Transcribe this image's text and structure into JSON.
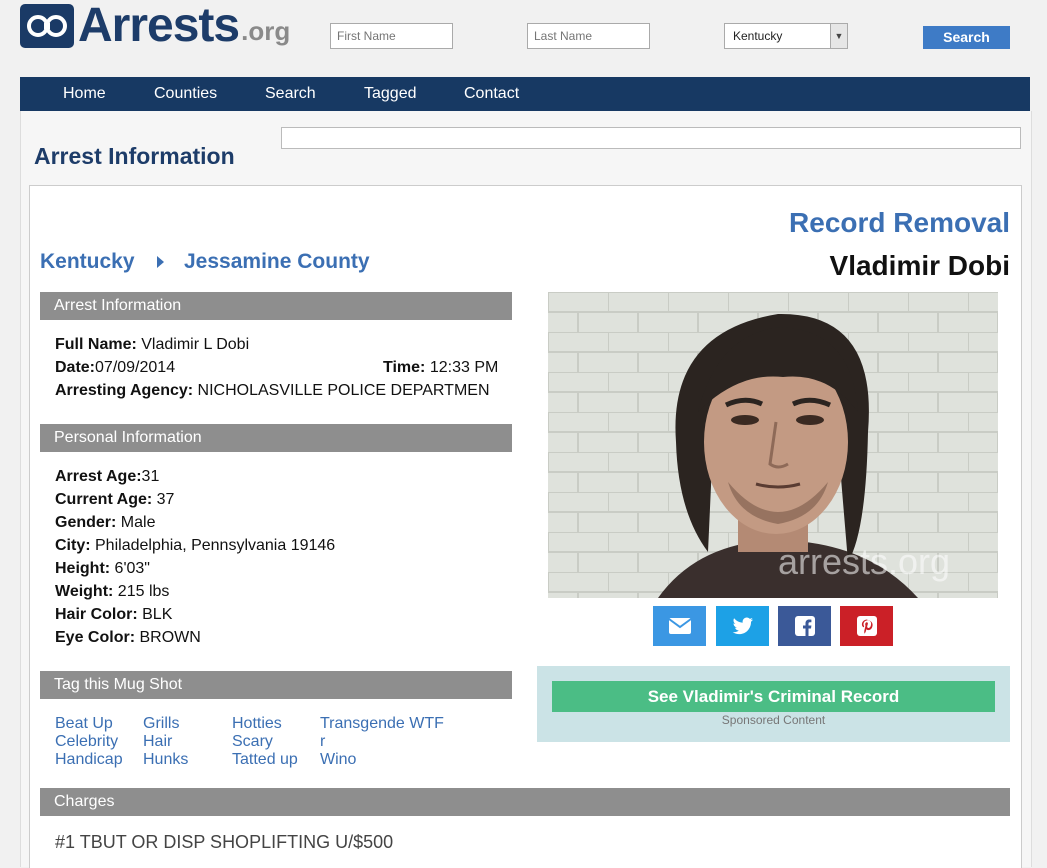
{
  "header": {
    "logo_word": "Arrests",
    "logo_tld": ".org",
    "first_name_placeholder": "First Name",
    "last_name_placeholder": "Last Name",
    "state_selected": "Kentucky",
    "search_label": "Search"
  },
  "nav": {
    "items": [
      "Home",
      "Counties",
      "Search",
      "Tagged",
      "Contact"
    ]
  },
  "page": {
    "title": "Arrest Information"
  },
  "breadcrumb": {
    "state": "Kentucky",
    "county": "Jessamine County"
  },
  "record_removal": "Record Removal",
  "person_name": "Vladimir Dobi",
  "arrest_info": {
    "header": "Arrest Information",
    "full_name_label": "Full Name:",
    "full_name": " Vladimir L Dobi",
    "date_label": "Date:",
    "date": "07/09/2014",
    "time_label": "Time:",
    "time": " 12:33 PM",
    "agency_label": "Arresting Agency:",
    "agency": " NICHOLASVILLE POLICE DEPARTMEN"
  },
  "personal_info": {
    "header": "Personal Information",
    "fields": [
      {
        "label": "Arrest Age:",
        "value": "31"
      },
      {
        "label": "Current Age:",
        "value": " 37"
      },
      {
        "label": "Gender:",
        "value": " Male"
      },
      {
        "label": "City:",
        "value": " Philadelphia, Pennsylvania 19146"
      },
      {
        "label": "Height:",
        "value": " 6'03\""
      },
      {
        "label": "Weight:",
        "value": " 215 lbs"
      },
      {
        "label": "Hair Color:",
        "value": " BLK"
      },
      {
        "label": "Eye Color:",
        "value": " BROWN"
      }
    ]
  },
  "tags": {
    "header": "Tag this Mug Shot",
    "col1": [
      "Beat Up",
      "Celebrity",
      "Handicap"
    ],
    "col2": [
      "Grills",
      "Hair",
      "Hunks"
    ],
    "col3": [
      "Hotties",
      "Scary",
      "Tatted up"
    ],
    "col4": [
      "Transgende WTF",
      "r",
      "Wino"
    ]
  },
  "photo": {
    "watermark": "arrests.org"
  },
  "share": {
    "icons": [
      "email-icon",
      "twitter-icon",
      "facebook-icon",
      "pinterest-icon"
    ],
    "colors": [
      "#3b97e3",
      "#1da1e6",
      "#3b5998",
      "#cb2027"
    ]
  },
  "sponsored": {
    "button_label": "See Vladimir's Criminal Record",
    "note": "Sponsored Content"
  },
  "charges": {
    "header": "Charges",
    "items": [
      "#1 TBUT OR DISP SHOPLIFTING U/$500"
    ]
  }
}
